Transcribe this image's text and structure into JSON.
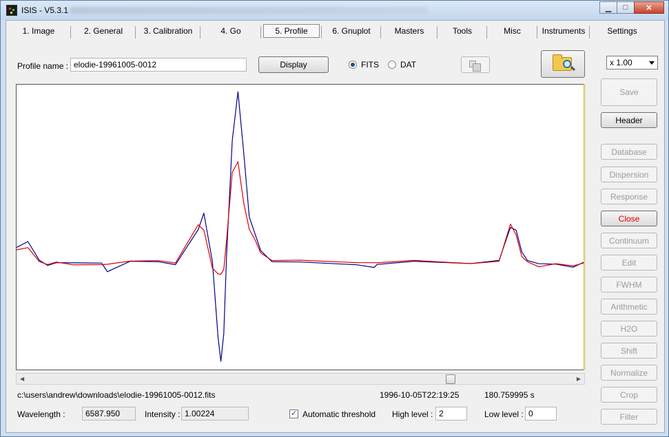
{
  "window": {
    "title": "ISIS - V5.3.1",
    "controls": {
      "minimize": "▁",
      "maximize": "□",
      "close": "✕"
    }
  },
  "tabs": [
    {
      "label": "1. Image"
    },
    {
      "label": "2. General"
    },
    {
      "label": "3. Calibration"
    },
    {
      "label": "4. Go"
    },
    {
      "label": "5. Profile",
      "active": true
    },
    {
      "label": "6. Gnuplot"
    },
    {
      "label": "Masters"
    },
    {
      "label": "Tools"
    },
    {
      "label": "Misc"
    },
    {
      "label": "Instruments"
    },
    {
      "label": "Settings"
    }
  ],
  "profile": {
    "name_label": "Profile name :",
    "name_value": "elodie-19961005-0012",
    "display_label": "Display",
    "format_fits": "FITS",
    "format_dat": "DAT",
    "selected_format": "FITS"
  },
  "zoom": {
    "value": "x 1.00"
  },
  "sidebar": {
    "save": "Save",
    "header": "Header",
    "database": "Database",
    "dispersion": "Dispersion",
    "response": "Response",
    "close": "Close",
    "continuum": "Continuum",
    "edit": "Edit",
    "fwhm": "FWHM",
    "arithmetic": "Arithmetic",
    "h2o": "H2O",
    "shift": "Shift",
    "normalize": "Normalize",
    "crop": "Crop",
    "filter": "Filter"
  },
  "status": {
    "file_path": "c:\\users\\andrew\\downloads\\elodie-19961005-0012.fits",
    "date": "1996-10-05T22:19:25",
    "exposure": "180.759995 s"
  },
  "readout": {
    "wavelength_label": "Wavelength :",
    "wavelength_value": "6587.950",
    "intensity_label": "Intensity :",
    "intensity_value": "1.00224",
    "auto_threshold_label": "Automatic threshold",
    "auto_threshold_checked": true,
    "high_level_label": "High level :",
    "high_level_value": "2",
    "low_level_label": "Low level :",
    "low_level_value": "0"
  },
  "scroll": {
    "position_fraction": 0.78
  },
  "chart_data": {
    "type": "line",
    "series": [
      {
        "color": "#00008b",
        "x": [
          0,
          0.02,
          0.04,
          0.055,
          0.07,
          0.1,
          0.15,
          0.16,
          0.2,
          0.25,
          0.28,
          0.32,
          0.33,
          0.345,
          0.355,
          0.36,
          0.365,
          0.37,
          0.38,
          0.39,
          0.4,
          0.41,
          0.42,
          0.43,
          0.45,
          0.5,
          0.6,
          0.63,
          0.635,
          0.7,
          0.8,
          0.85,
          0.86,
          0.87,
          0.88,
          0.89,
          0.9,
          0.92,
          0.95,
          0.98,
          1
        ],
        "y": [
          1.05,
          1.07,
          1.0,
          0.98,
          0.99,
          0.99,
          0.99,
          0.96,
          1.0,
          1.0,
          0.99,
          1.12,
          1.18,
          1.0,
          0.72,
          0.63,
          0.73,
          1.02,
          1.44,
          1.62,
          1.4,
          1.16,
          1.1,
          1.04,
          1.0,
          1.0,
          0.99,
          0.98,
          0.99,
          1.0,
          0.99,
          1.0,
          1.06,
          1.12,
          1.11,
          1.03,
          1.0,
          0.99,
          0.99,
          0.98,
          1.0
        ]
      },
      {
        "color": "#dd0000",
        "x": [
          0,
          0.02,
          0.04,
          0.055,
          0.07,
          0.1,
          0.15,
          0.16,
          0.2,
          0.25,
          0.28,
          0.32,
          0.33,
          0.345,
          0.355,
          0.36,
          0.365,
          0.37,
          0.38,
          0.39,
          0.4,
          0.41,
          0.42,
          0.43,
          0.45,
          0.5,
          0.6,
          0.63,
          0.635,
          0.7,
          0.8,
          0.85,
          0.86,
          0.87,
          0.88,
          0.89,
          0.9,
          0.92,
          0.95,
          0.98,
          1
        ],
        "y": [
          1.04,
          1.05,
          1.0,
          0.99,
          1.0,
          0.99,
          0.99,
          0.99,
          1.0,
          1.0,
          0.99,
          1.13,
          1.11,
          0.97,
          0.95,
          0.95,
          0.97,
          1.08,
          1.33,
          1.37,
          1.22,
          1.12,
          1.08,
          1.03,
          1.0,
          1.0,
          0.99,
          0.99,
          0.99,
          1.0,
          0.99,
          1.0,
          1.07,
          1.14,
          1.1,
          1.02,
          1.0,
          0.98,
          0.99,
          0.98,
          0.99
        ]
      }
    ],
    "xlim": [
      0,
      1
    ],
    "ylim": [
      0.6,
      1.65
    ]
  }
}
